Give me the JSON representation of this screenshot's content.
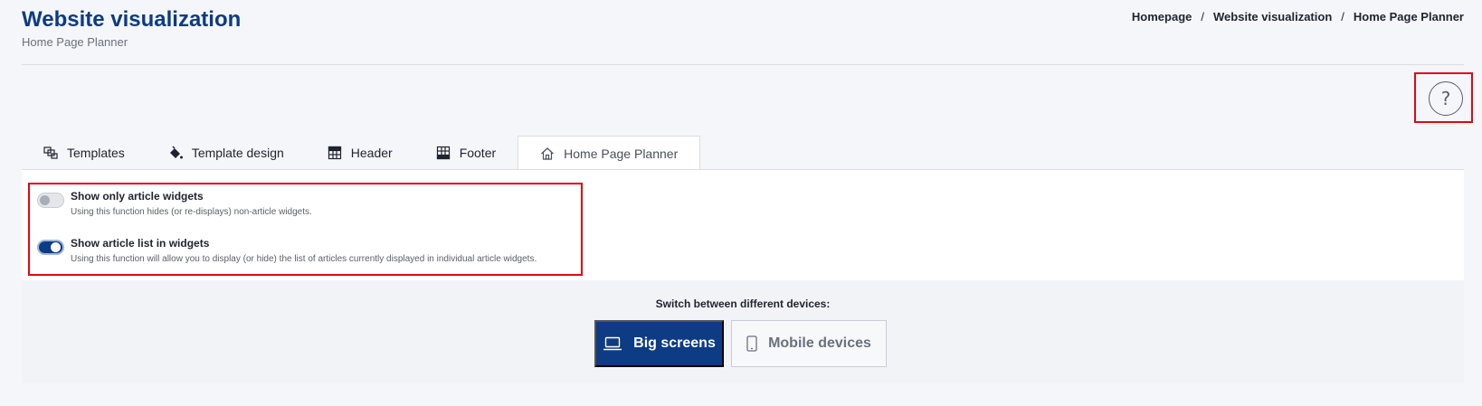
{
  "header": {
    "title": "Website visualization",
    "subtitle": "Home Page Planner",
    "breadcrumb": [
      "Homepage",
      "Website visualization",
      "Home Page Planner"
    ],
    "breadcrumb_separator": "/"
  },
  "help": {
    "label": "?",
    "icon": "help-circle-icon"
  },
  "tabs": [
    {
      "label": "Templates",
      "icon": "templates-icon",
      "active": false
    },
    {
      "label": "Template design",
      "icon": "paint-bucket-icon",
      "active": false
    },
    {
      "label": "Header",
      "icon": "layout-header-icon",
      "active": false
    },
    {
      "label": "Footer",
      "icon": "layout-footer-icon",
      "active": false
    },
    {
      "label": "Home Page Planner",
      "icon": "home-icon",
      "active": true
    }
  ],
  "options": [
    {
      "title": "Show only article widgets",
      "description": "Using this function hides (or re-displays) non-article widgets.",
      "enabled": false
    },
    {
      "title": "Show article list in widgets",
      "description": "Using this function will allow you to display (or hide) the list of articles currently displayed in individual article widgets.",
      "enabled": true
    }
  ],
  "devices": {
    "label": "Switch between different devices:",
    "big_screens": "Big screens",
    "mobile_devices": "Mobile devices",
    "selected": "Big screens"
  },
  "colors": {
    "brand": "#0d3b84",
    "highlight": "#e30613",
    "background": "#f5f6f9"
  }
}
